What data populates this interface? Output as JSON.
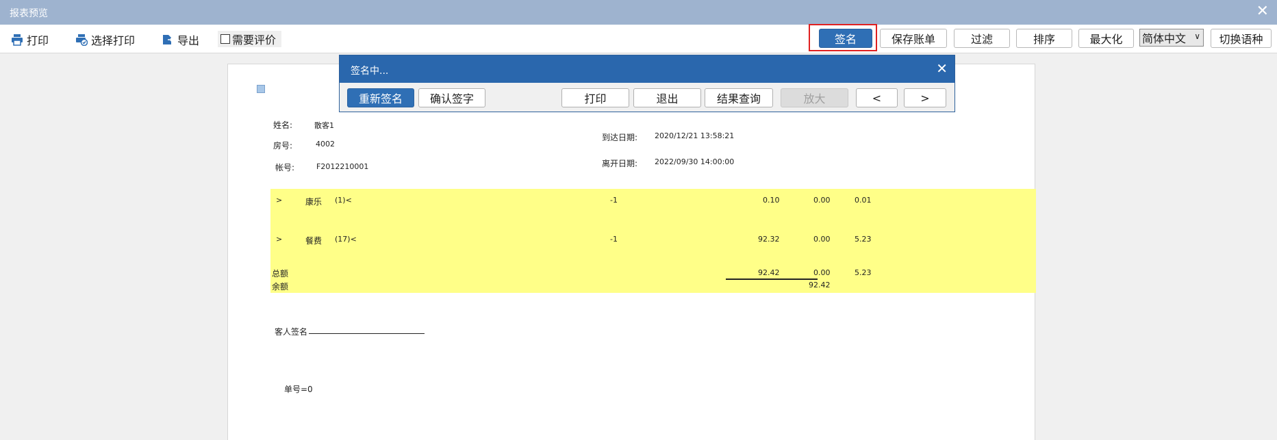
{
  "window": {
    "title": "报表预览",
    "close_glyph": "✕"
  },
  "toolbar": {
    "print": {
      "label": "打印",
      "icon": "printer-icon"
    },
    "select_print": {
      "label": "选择打印",
      "icon": "select-print-icon"
    },
    "export": {
      "label": "导出",
      "icon": "export-icon"
    },
    "need_review": {
      "label": "需要评价",
      "checked": false
    },
    "sign": "签名",
    "save_bill": "保存账单",
    "filter": "过滤",
    "sort": "排序",
    "maximize": "最大化",
    "language": {
      "selected": "简体中文",
      "arrow": "∨"
    },
    "switch_language": "切换语种",
    "colors": {
      "primary": "#2f6fb5",
      "highlight": "#e02020"
    }
  },
  "dialog": {
    "title": "签名中...",
    "close_glyph": "✕",
    "buttons": {
      "resign": "重新签名",
      "confirm_sign": "确认签字",
      "print": "打印",
      "exit": "退出",
      "result_query": "结果查询",
      "zoom": "放大",
      "prev": "<",
      "next": ">"
    }
  },
  "report": {
    "guest_name_label": "姓名:",
    "guest_name": "散客1",
    "room_label": "房号:",
    "room": "4002",
    "account_label": "帐号:",
    "account": "F2012210001",
    "arrival_label": "到达日期:",
    "arrival": "2020/12/21 13:58:21",
    "departure_label": "离开日期:",
    "departure": "2022/09/30 14:00:00",
    "items": [
      {
        "expander": ">",
        "name": "康乐",
        "count": "(1)<",
        "qty": "-1",
        "amount": "0.10",
        "paid": "0.00",
        "tax": "0.01"
      },
      {
        "expander": ">",
        "name": "餐费",
        "count": "(17)<",
        "qty": "-1",
        "amount": "92.32",
        "paid": "0.00",
        "tax": "5.23"
      }
    ],
    "total_label": "总额",
    "total_amount": "92.42",
    "total_paid": "0.00",
    "total_tax": "5.23",
    "balance_label": "余额",
    "balance": "92.42",
    "guest_signature_label": "客人签名",
    "bill_no_label": "单号=0",
    "highlight_color": "#ffff88"
  }
}
